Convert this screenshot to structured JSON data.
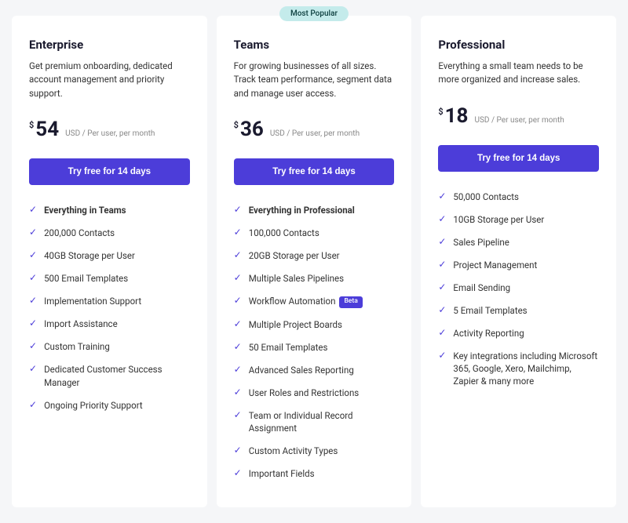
{
  "badge": "Most Popular",
  "plans": [
    {
      "title": "Enterprise",
      "description": "Get premium onboarding, dedicated account management and priority support.",
      "currency": "$",
      "price": "54",
      "unit": "USD / Per user, per month",
      "cta": "Try free for 14 days",
      "features": [
        {
          "text": "Everything in Teams",
          "bold": true
        },
        {
          "text": "200,000 Contacts"
        },
        {
          "text": "40GB Storage per User"
        },
        {
          "text": "500 Email Templates"
        },
        {
          "text": "Implementation Support"
        },
        {
          "text": "Import Assistance"
        },
        {
          "text": "Custom Training"
        },
        {
          "text": "Dedicated Customer Success Manager"
        },
        {
          "text": "Ongoing Priority Support"
        }
      ]
    },
    {
      "title": "Teams",
      "description": "For growing businesses of all sizes. Track team performance, segment data and manage user access.",
      "currency": "$",
      "price": "36",
      "unit": "USD / Per user, per month",
      "cta": "Try free for 14 days",
      "popular": true,
      "features": [
        {
          "text": "Everything in Professional",
          "bold": true
        },
        {
          "text": "100,000 Contacts"
        },
        {
          "text": "20GB Storage per User"
        },
        {
          "text": "Multiple Sales Pipelines"
        },
        {
          "text": "Workflow Automation",
          "badge": "Beta"
        },
        {
          "text": "Multiple Project Boards"
        },
        {
          "text": "50 Email Templates"
        },
        {
          "text": "Advanced Sales Reporting"
        },
        {
          "text": "User Roles and Restrictions"
        },
        {
          "text": "Team or Individual Record Assignment"
        },
        {
          "text": "Custom Activity Types"
        },
        {
          "text": "Important Fields"
        }
      ]
    },
    {
      "title": "Professional",
      "description": "Everything a small team needs to be more organized and increase sales.",
      "currency": "$",
      "price": "18",
      "unit": "USD / Per user, per month",
      "cta": "Try free for 14 days",
      "features": [
        {
          "text": "50,000 Contacts"
        },
        {
          "text": "10GB Storage per User"
        },
        {
          "text": "Sales Pipeline"
        },
        {
          "text": "Project Management"
        },
        {
          "text": "Email Sending"
        },
        {
          "text": "5 Email Templates"
        },
        {
          "text": "Activity Reporting"
        },
        {
          "text": "Key integrations including Microsoft 365, Google, Xero, Mailchimp, Zapier & many more"
        }
      ]
    }
  ]
}
